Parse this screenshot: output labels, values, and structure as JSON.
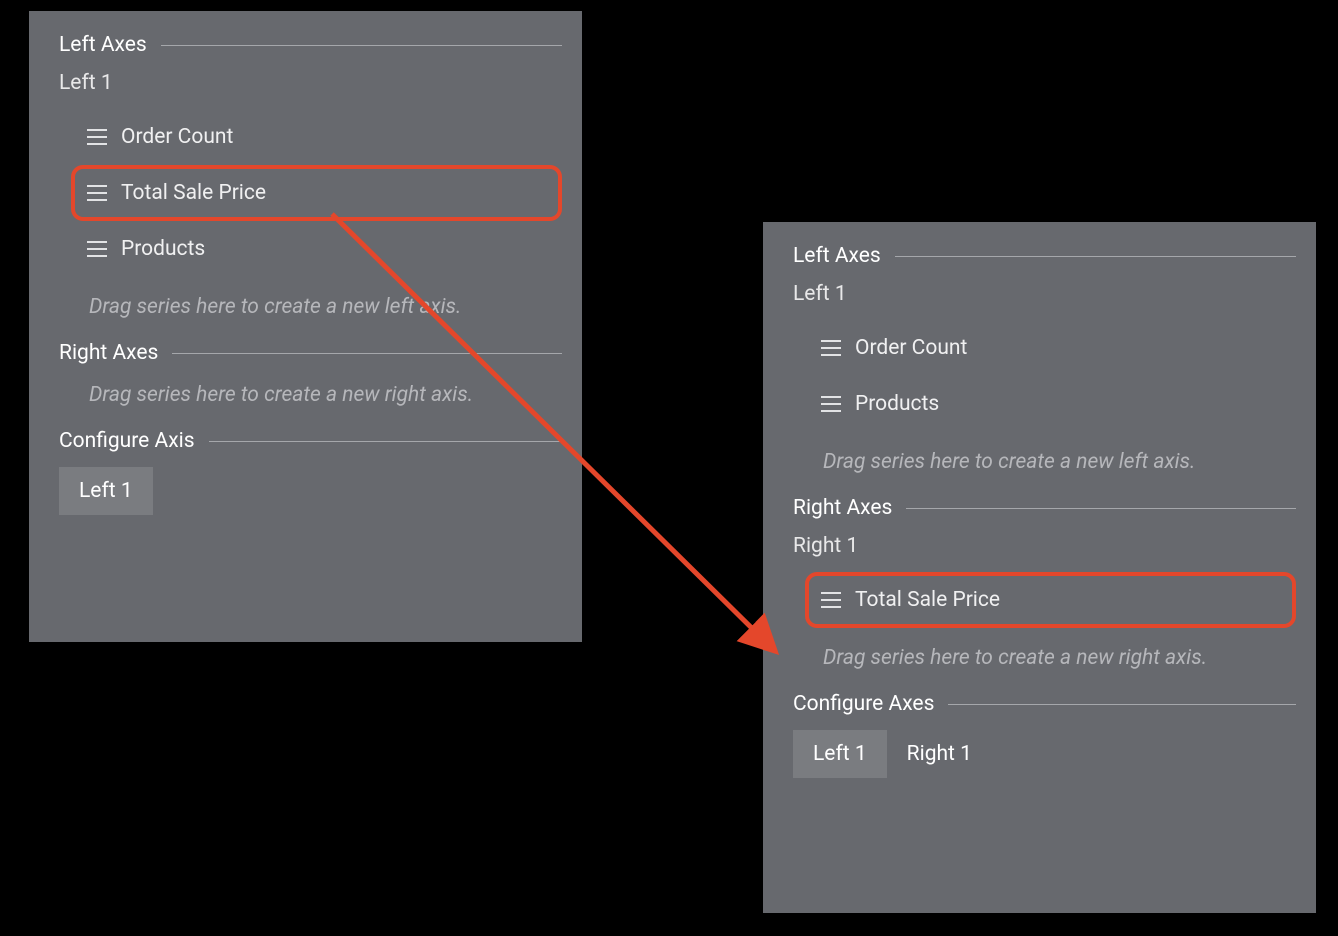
{
  "colors": {
    "highlight": "#e4472b",
    "panel_bg": "#67696e"
  },
  "left_panel": {
    "left_axes": {
      "title": "Left Axes",
      "axis_name": "Left 1",
      "series": [
        {
          "label": "Order Count",
          "highlighted": false
        },
        {
          "label": "Total Sale Price",
          "highlighted": true
        },
        {
          "label": "Products",
          "highlighted": false
        }
      ],
      "drop_hint": "Drag series here to create a new left axis."
    },
    "right_axes": {
      "title": "Right Axes",
      "drop_hint": "Drag series here to create a new right axis."
    },
    "configure": {
      "title": "Configure Axis",
      "tabs": [
        {
          "label": "Left 1",
          "active": true
        }
      ]
    }
  },
  "right_panel": {
    "left_axes": {
      "title": "Left Axes",
      "axis_name": "Left 1",
      "series": [
        {
          "label": "Order Count",
          "highlighted": false
        },
        {
          "label": "Products",
          "highlighted": false
        }
      ],
      "drop_hint": "Drag series here to create a new left axis."
    },
    "right_axes": {
      "title": "Right Axes",
      "axis_name": "Right 1",
      "series": [
        {
          "label": "Total Sale Price",
          "highlighted": true
        }
      ],
      "drop_hint": "Drag series here to create a new right axis."
    },
    "configure": {
      "title": "Configure Axes",
      "tabs": [
        {
          "label": "Left 1",
          "active": true
        },
        {
          "label": "Right 1",
          "active": false
        }
      ]
    }
  }
}
